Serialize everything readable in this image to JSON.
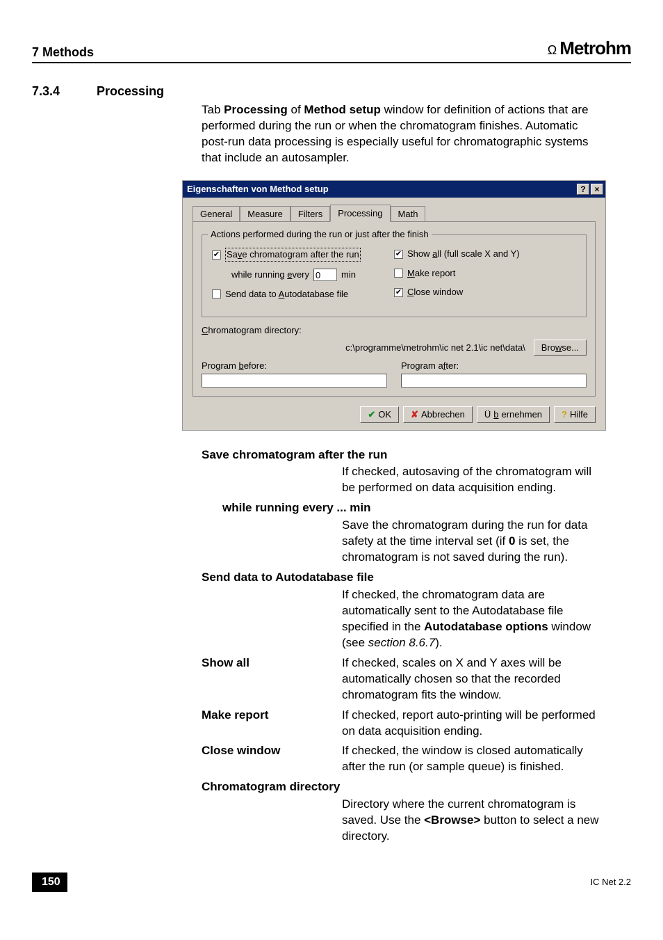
{
  "header": {
    "chapter": "7  Methods",
    "brand_symbol": "Ω",
    "brand_name": "Metrohm"
  },
  "section": {
    "number": "7.3.4",
    "title": "Processing"
  },
  "intro": {
    "t1": "Tab ",
    "b1": "Processing",
    "t2": " of ",
    "b2": "Method setup",
    "t3": " window for definition of actions that are performed during the run or when the chromatogram finishes. Automatic post-run data processing is especially useful for chromatographic systems that include an autosampler."
  },
  "dialog": {
    "title": "Eigenschaften von Method setup",
    "tabs": [
      "General",
      "Measure",
      "Filters",
      "Processing",
      "Math"
    ],
    "active_tab_index": 3,
    "group_title": "Actions performed during the run or just after the finish",
    "save_prefix": "Sa",
    "save_u": "v",
    "save_suffix": "e chromatogram after the run",
    "while_prefix": "while running ",
    "while_u": "e",
    "while_suffix": "very",
    "while_value": "0",
    "while_unit": "min",
    "autodb_prefix": "Send data to ",
    "autodb_u": "A",
    "autodb_suffix": "utodatabase file",
    "showall_prefix": "Show ",
    "showall_u": "a",
    "showall_suffix": "ll (full scale X and Y)",
    "report_u": "M",
    "report_suffix": "ake report",
    "close_u": "C",
    "close_suffix": "lose window",
    "dir_u": "C",
    "dir_label_suffix": "hromatogram directory:",
    "dir_path": "c:\\programme\\metrohm\\ic net 2.1\\ic net\\data\\",
    "browse_prefix": "Bro",
    "browse_u": "w",
    "browse_suffix": "se...",
    "before_prefix": "Program ",
    "before_u": "b",
    "before_suffix": "efore:",
    "after_prefix": "Program a",
    "after_u": "f",
    "after_suffix": "ter:",
    "btn_ok": "OK",
    "btn_cancel": "Abbrechen",
    "btn_apply_prefix": "Ü",
    "btn_apply_u": "b",
    "btn_apply_suffix": "ernehmen",
    "btn_help": "Hilfe"
  },
  "defs": {
    "save_term": "Save chromatogram after the run",
    "save_body": "If checked, autosaving of the chromatogram will be performed on data acquisition ending.",
    "while_term": "while running every ... min",
    "while_p1": "Save the chromatogram during the run for data safety at the time interval set (if ",
    "while_b": "0",
    "while_p2": " is set, the chromatogram is not saved during the run).",
    "autodb_term": "Send data to Autodatabase file",
    "autodb_p1": "If checked, the chromatogram data are automatically sent to the Autodatabase file specified in the ",
    "autodb_b": "Autodatabase options",
    "autodb_p2": " window (see ",
    "autodb_i": "section 8.6.7",
    "autodb_p3": ").",
    "showall_term": "Show all",
    "showall_body": "If checked, scales on X and Y axes will be automatically chosen so that the recorded chromatogram fits the window.",
    "report_term": "Make report",
    "report_body": "If checked, report auto-printing will be performed on data acquisition ending.",
    "close_term": "Close window",
    "close_body": "If checked, the window is closed automatically after the run (or sample queue) is finished.",
    "dir_term": "Chromatogram directory",
    "dir_p1": "Directory where the current chromatogram is saved. Use the ",
    "dir_b": "<Browse>",
    "dir_p2": " button to select a new directory."
  },
  "footer": {
    "page_num": "150",
    "product": "IC Net 2.2"
  }
}
